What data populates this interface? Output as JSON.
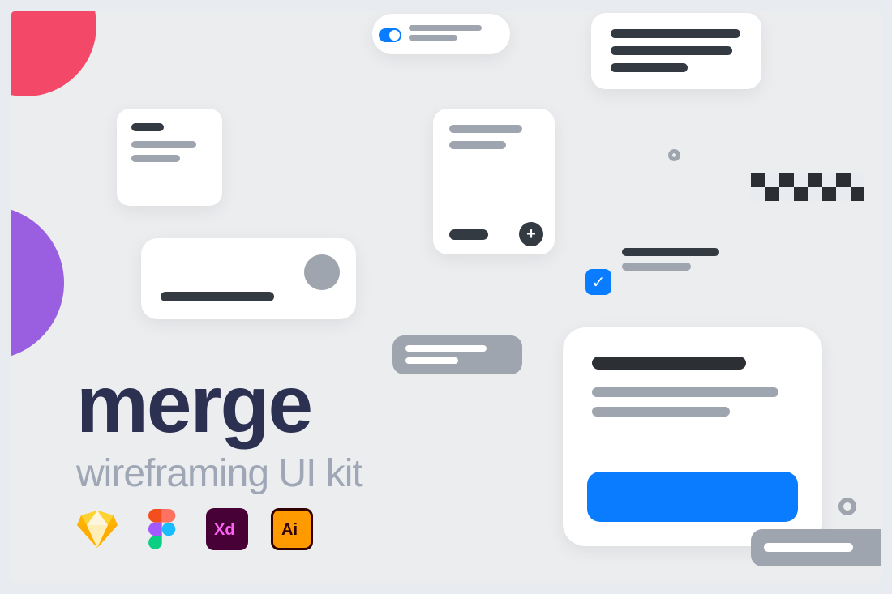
{
  "title": "merge",
  "subtitle": "wireframing UI kit",
  "apps": {
    "sketch": "sketch-icon",
    "figma": "figma-icon",
    "xd": "xd-icon",
    "illustrator": "illustrator-icon"
  },
  "colors": {
    "accent_blue": "#0a7cff",
    "text_dark": "#2c3152",
    "text_grey": "#9fa7b6",
    "circle_pink": "#f44868",
    "circle_purple": "#9a5fe0"
  }
}
